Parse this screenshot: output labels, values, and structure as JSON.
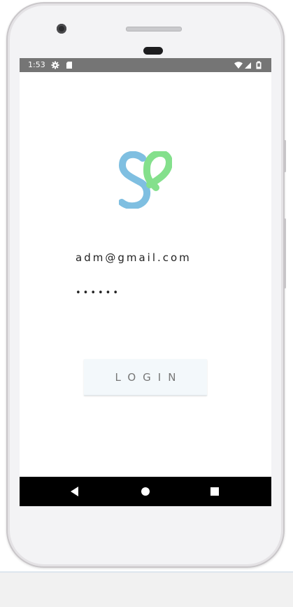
{
  "status_bar": {
    "time": "1:53",
    "icons": [
      "settings-icon",
      "sd-card-icon",
      "wifi-icon",
      "signal-icon",
      "battery-icon"
    ]
  },
  "app": {
    "logo_icon": "heart-s-logo",
    "logo_colors": {
      "blue": "#7fbfe1",
      "green": "#84e08c"
    }
  },
  "login_form": {
    "email_value": "adm@gmail.com",
    "password_value": "••••••",
    "login_label": "LOGIN"
  },
  "nav_bar": {
    "buttons": [
      "back-icon",
      "home-icon",
      "recents-icon"
    ]
  }
}
